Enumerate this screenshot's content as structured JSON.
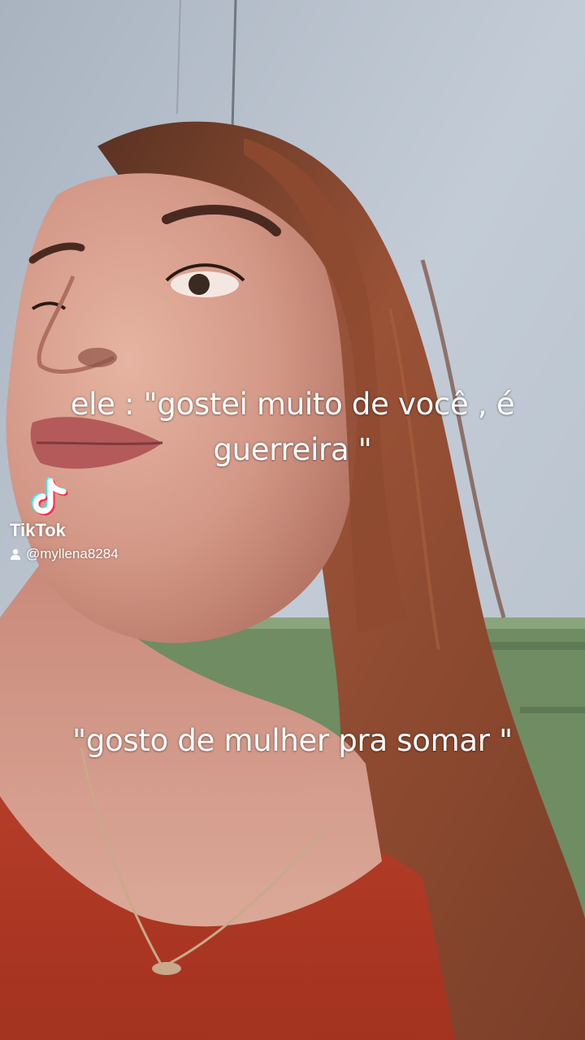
{
  "captions": {
    "top": "ele : \"gostei muito de você , é guerreira \"",
    "bottom": "\"gosto de mulher pra somar \""
  },
  "watermark": {
    "brand": "TikTok",
    "username": "@myllena8284",
    "logo_icon": "tiktok-note-icon",
    "user_icon": "person-icon"
  },
  "colors": {
    "wall": "#b9c4d0",
    "green_wall": "#6e8c62",
    "hair": "#8a4a30",
    "skin": "#d59a88",
    "shirt": "#b53a26",
    "tiktok_cyan": "#25f4ee",
    "tiktok_red": "#fe2c55"
  }
}
